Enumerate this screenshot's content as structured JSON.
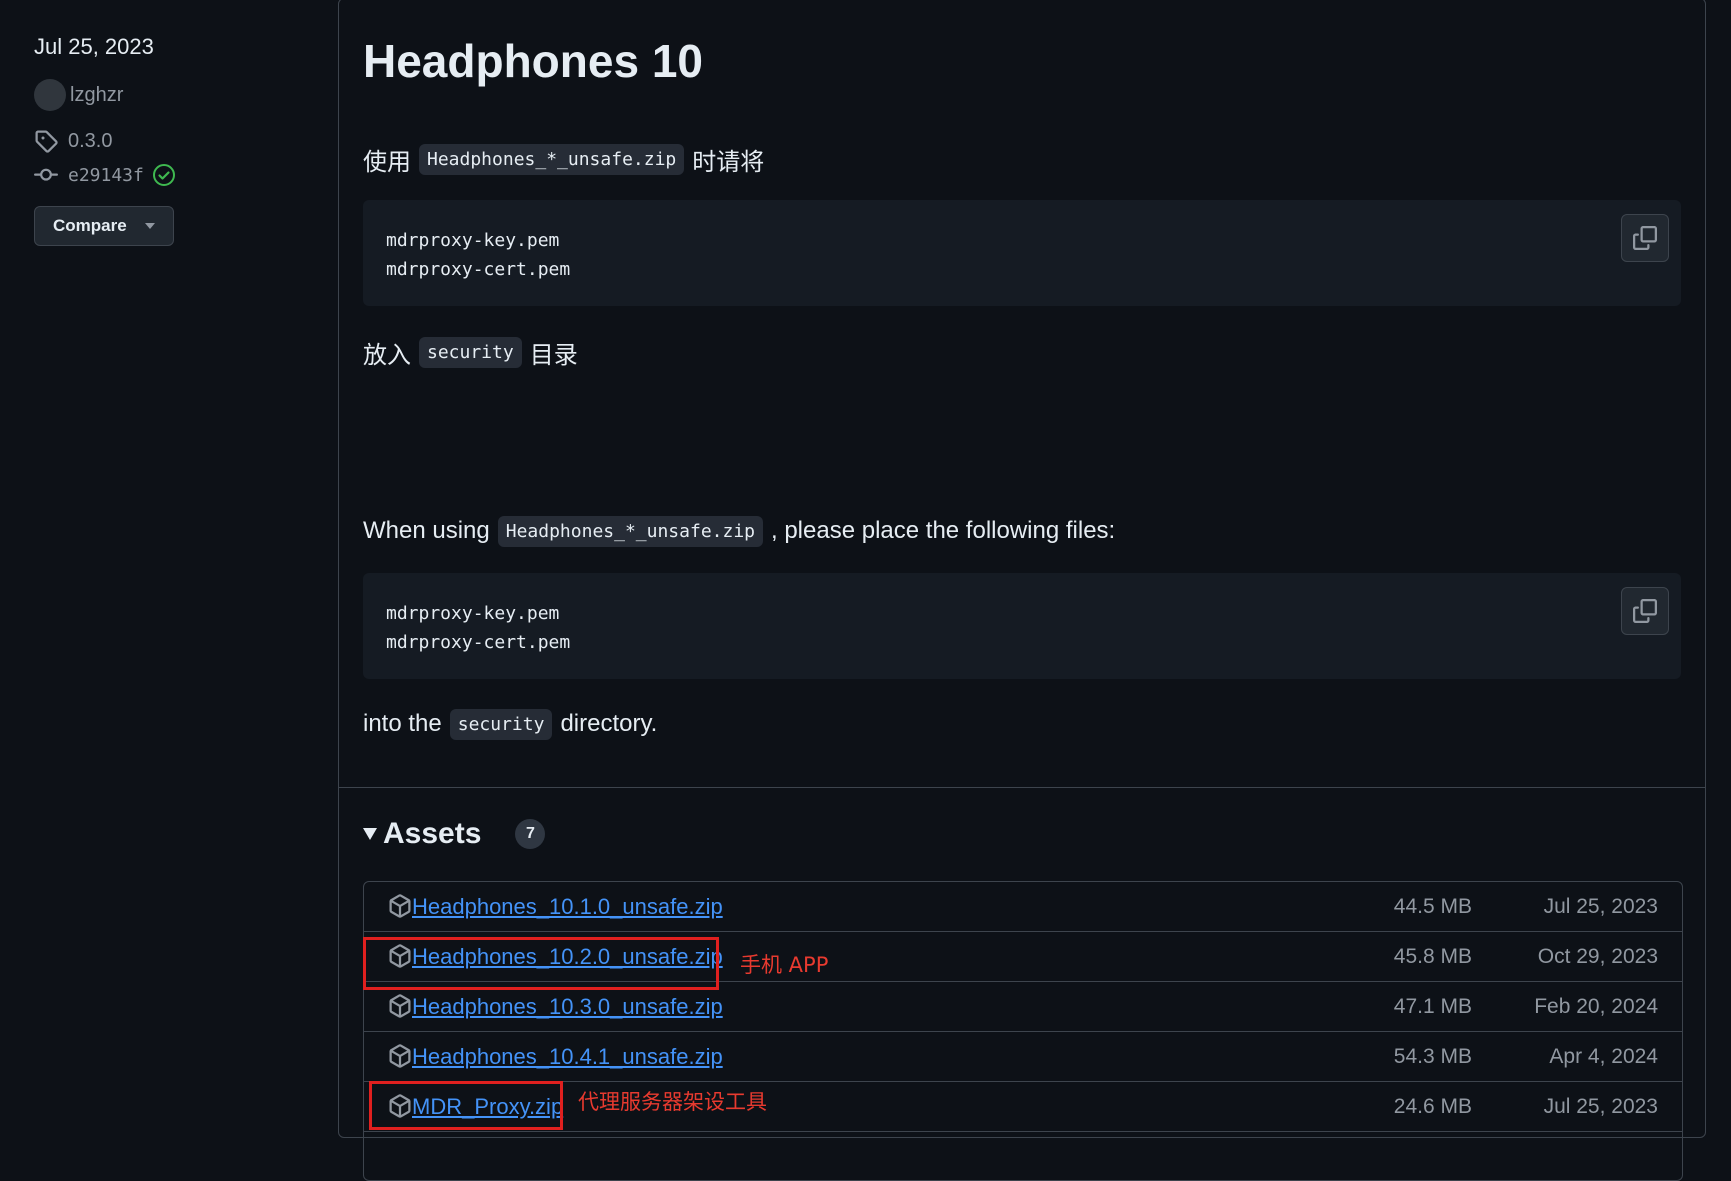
{
  "meta": {
    "date": "Jul 25, 2023",
    "author": "lzghzr",
    "tag": "0.3.0",
    "commit": "e29143f",
    "compare_label": "Compare"
  },
  "release": {
    "title": "Headphones 10",
    "zh_intro_before": "使用",
    "zh_intro_code": "Headphones_*_unsafe.zip",
    "zh_intro_after": "时请将",
    "code_block_1": [
      "mdrproxy-key.pem",
      "mdrproxy-cert.pem"
    ],
    "zh_place_before": "放入",
    "zh_place_code": "security",
    "zh_place_after": "目录",
    "en_intro_before": "When using",
    "en_intro_code": "Headphones_*_unsafe.zip",
    "en_intro_after": ", please place the following files:",
    "code_block_2": [
      "mdrproxy-key.pem",
      "mdrproxy-cert.pem"
    ],
    "en_place_before": "into the",
    "en_place_code": "security",
    "en_place_after": "directory."
  },
  "assets": {
    "title": "Assets",
    "count": "7",
    "items": [
      {
        "name": "Headphones_10.1.0_unsafe.zip",
        "size": "44.5 MB",
        "date": "Jul 25, 2023"
      },
      {
        "name": "Headphones_10.2.0_unsafe.zip",
        "size": "45.8 MB",
        "date": "Oct 29, 2023"
      },
      {
        "name": "Headphones_10.3.0_unsafe.zip",
        "size": "47.1 MB",
        "date": "Feb 20, 2024"
      },
      {
        "name": "Headphones_10.4.1_unsafe.zip",
        "size": "54.3 MB",
        "date": "Apr 4, 2024"
      },
      {
        "name": "MDR_Proxy.zip",
        "size": "24.6 MB",
        "date": "Jul 25, 2023"
      }
    ]
  },
  "annotations": {
    "phone_app": "手机 APP",
    "proxy_tool": "代理服务器架设工具",
    "color": "#e0201f"
  },
  "colors": {
    "background": "#0d1117",
    "link": "#4493f8",
    "success": "#3fb950"
  }
}
